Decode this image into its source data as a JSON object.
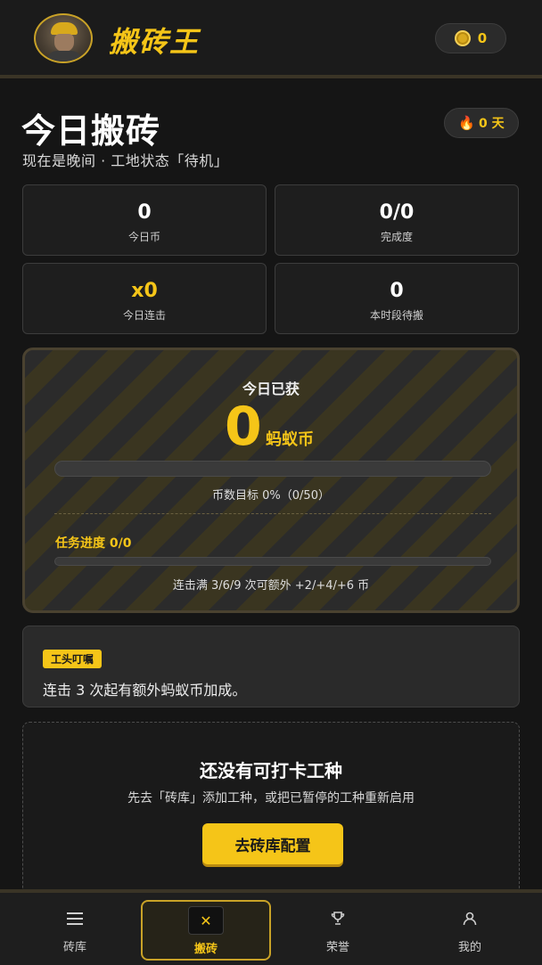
{
  "header": {
    "app_title": "搬砖王",
    "coin_count": "0",
    "avatar_icon": "worker-avatar",
    "coin_icon": "coin-icon"
  },
  "page": {
    "title": "今日搬砖",
    "streak": "0 天",
    "subtitle": "现在是晚间 · 工地状态「待机」"
  },
  "stats": [
    {
      "value": "0",
      "label": "今日币"
    },
    {
      "value": "0/0",
      "label": "完成度"
    },
    {
      "value": "x0",
      "label": "今日连击"
    },
    {
      "value": "0",
      "label": "本时段待搬"
    }
  ],
  "earnings": {
    "label": "今日已获",
    "amount": "0",
    "unit": "蚂蚁币",
    "goal_text": "币数目标 0%（0/50）",
    "goal_progress": 0,
    "task_progress_text": "任务进度 0/0",
    "task_progress": 0,
    "combo_tip": "连击满 3/6/9 次可额外 +2/+4/+6 币"
  },
  "tip": {
    "badge": "工头叮嘱",
    "text": "连击 3 次起有额外蚂蚁币加成。"
  },
  "empty_state": {
    "title": "还没有可打卡工种",
    "description": "先去「砖库」添加工种，或把已暂停的工种重新启用",
    "button": "去砖库配置"
  },
  "nav": {
    "items": [
      {
        "label": "砖库",
        "icon": "menu-icon"
      },
      {
        "label": "搬砖",
        "icon": "brick-icon"
      },
      {
        "label": "荣誉",
        "icon": "trophy-icon"
      },
      {
        "label": "我的",
        "icon": "user-icon"
      }
    ],
    "active_index": 1
  },
  "colors": {
    "accent": "#f5c518",
    "background": "#151515",
    "card": "#1e1e1e"
  }
}
